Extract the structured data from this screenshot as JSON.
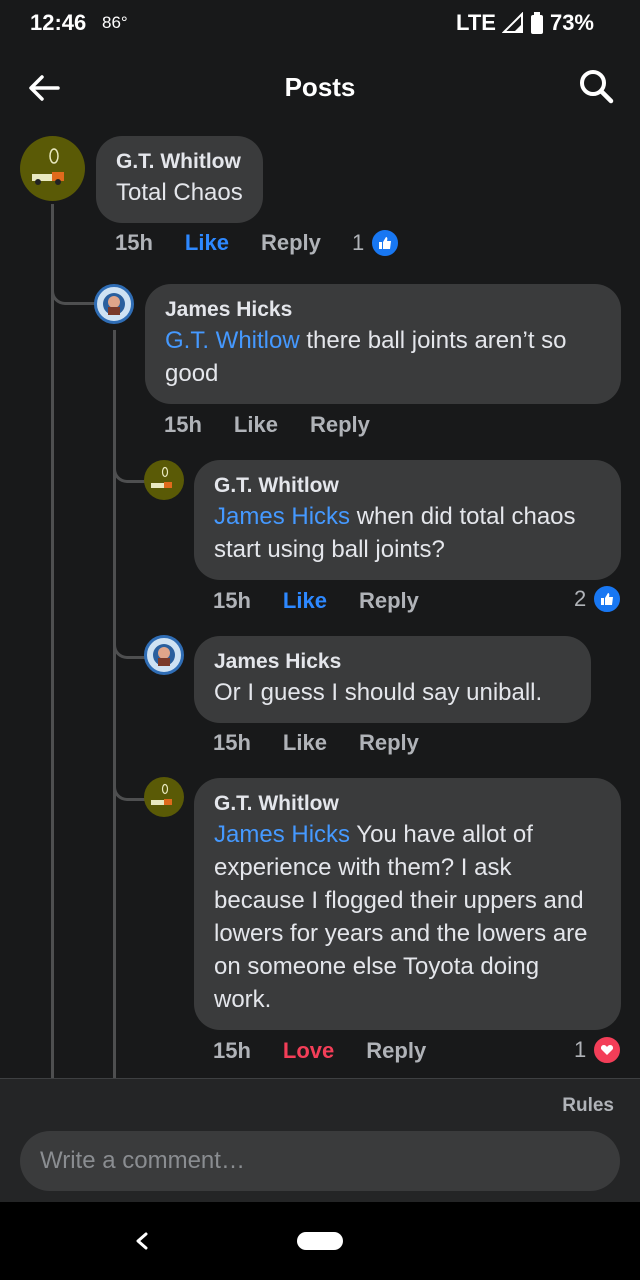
{
  "status_bar": {
    "time": "12:46",
    "temperature": "86°",
    "network": "LTE",
    "battery": "73%"
  },
  "header": {
    "title": "Posts",
    "back_icon": "arrow-left-icon",
    "search_icon": "search-icon"
  },
  "comments": [
    {
      "author": "G.T. Whitlow",
      "mention": "",
      "text": "Total Chaos",
      "time": "15h",
      "like_label": "Like",
      "reply_label": "Reply",
      "reaction_count": "1",
      "reaction": "like",
      "liked": true
    },
    {
      "author": "James Hicks",
      "mention": "G.T. Whitlow",
      "text": " there ball joints aren’t so good",
      "time": "15h",
      "like_label": "Like",
      "reply_label": "Reply",
      "reaction_count": "",
      "reaction": "",
      "liked": false
    },
    {
      "author": "G.T. Whitlow",
      "mention": "James Hicks",
      "text": " when did total chaos start using ball joints?",
      "time": "15h",
      "like_label": "Like",
      "reply_label": "Reply",
      "reaction_count": "2",
      "reaction": "like",
      "liked": true
    },
    {
      "author": "James Hicks",
      "mention": "",
      "text": "Or I guess I should say uniball.",
      "time": "15h",
      "like_label": "Like",
      "reply_label": "Reply",
      "reaction_count": "",
      "reaction": "",
      "liked": false
    },
    {
      "author": "G.T. Whitlow",
      "mention": "James Hicks",
      "text": " You have allot of experience with them? I ask because I flogged their uppers and lowers for years and the lowers are on someone else Toyota doing work.",
      "time": "15h",
      "like_label": "Love",
      "reply_label": "Reply",
      "reaction_count": "1",
      "reaction": "love",
      "liked": true
    }
  ],
  "footer": {
    "rules_label": "Rules",
    "comment_placeholder": "Write a comment…"
  },
  "colors": {
    "background": "#18191a",
    "bubble": "#3a3b3c",
    "mention": "#4599ff",
    "like": "#2d88ff",
    "love": "#f33e58"
  }
}
